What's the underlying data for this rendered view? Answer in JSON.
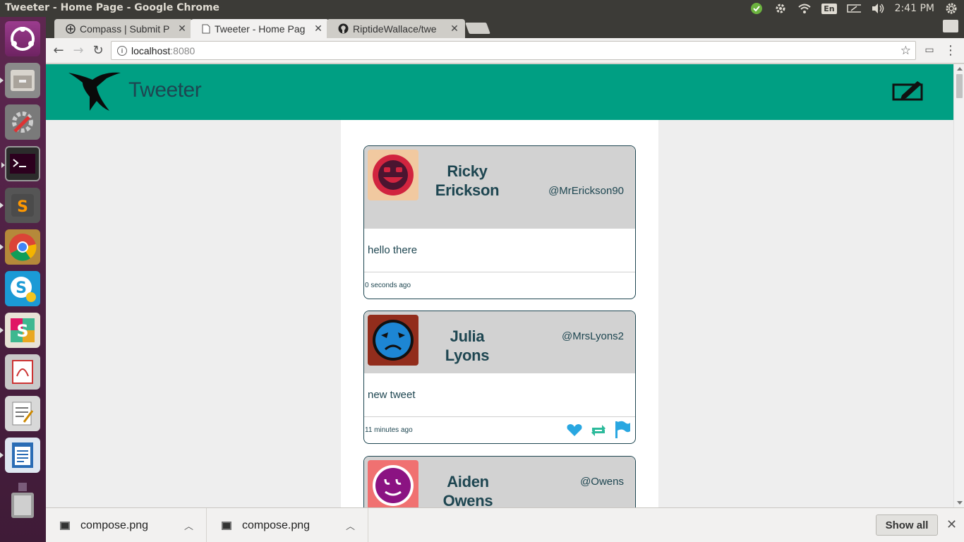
{
  "os": {
    "window_title": "Tweeter - Home Page - Google Chrome",
    "tray": {
      "language": "En",
      "clock": "2:41 PM"
    },
    "launcher": [
      "ubuntu-icon",
      "files-icon",
      "settings-icon",
      "terminal-icon",
      "sublime-text-icon",
      "chrome-icon",
      "skype-icon",
      "slack-icon",
      "pdf-viewer-icon",
      "text-editor-icon",
      "writer-icon",
      "trash-icon"
    ]
  },
  "browser": {
    "tabs": [
      {
        "label": "Compass | Submit P",
        "icon": "compass-icon"
      },
      {
        "label": "Tweeter - Home Pag",
        "icon": "page-icon",
        "active": true
      },
      {
        "label": "RiptideWallace/twe",
        "icon": "github-icon"
      }
    ],
    "url": {
      "host": "localhost",
      "port": ":8080"
    },
    "downloads": [
      {
        "name": "compose.png"
      },
      {
        "name": "compose.png"
      }
    ],
    "show_all": "Show all"
  },
  "app": {
    "title": "Tweeter",
    "colors": {
      "header": "#009f83",
      "text": "#1e4651",
      "like": "#29a7e1",
      "retweet": "#2cba9b",
      "flag": "#29a7e1"
    },
    "tweets": [
      {
        "name": "Ricky Erickson",
        "handle": "@MrErickson90",
        "text": "hello there",
        "time": "0 seconds ago",
        "avatar_bg": "#f1c9a0",
        "avatar_fg": "#d1243f"
      },
      {
        "name": "Julia Lyons",
        "handle": "@MrsLyons2",
        "text": "new tweet",
        "time": "11 minutes ago",
        "avatar_bg": "#922d1c",
        "avatar_fg": "#1d86d4"
      },
      {
        "name": "Aiden Owens",
        "handle": "@Owens",
        "avatar_bg": "#f07171",
        "avatar_fg": "#8b1382"
      }
    ]
  }
}
